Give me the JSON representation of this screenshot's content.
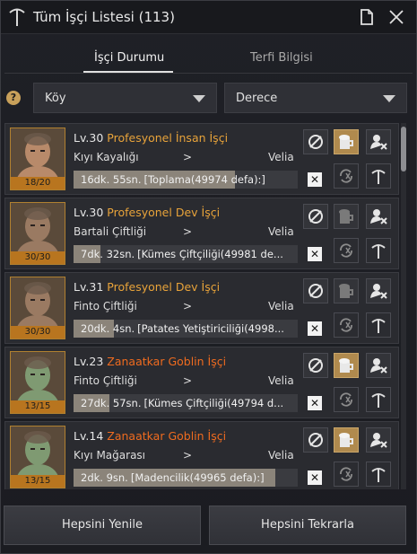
{
  "window": {
    "title": "Tüm İşçi Listesi (113)"
  },
  "tabs": [
    {
      "label": "İşçi Durumu",
      "active": true
    },
    {
      "label": "Terfi Bilgisi",
      "active": false
    }
  ],
  "filters": {
    "help_symbol": "?",
    "node_dropdown": "Köy",
    "grade_dropdown": "Derece"
  },
  "workers": [
    {
      "level": "Lv.30",
      "type": "Profesyonel İnsan İşçi",
      "type_color": "#e8a33a",
      "stamina": "18/20",
      "node": "Kıyı Kayalığı",
      "arrow": ">",
      "town": "Velia",
      "time": "16dk. 55sn.",
      "job": "[Toplama(49974 defa):]",
      "progress": 0.72,
      "skin": "#b88a6a",
      "gather_active": true
    },
    {
      "level": "Lv.30",
      "type": "Profesyonel Dev İşçi",
      "type_color": "#e8a33a",
      "stamina": "30/30",
      "node": "Bartali Çiftliği",
      "arrow": ">",
      "town": "Velia",
      "time": "7dk. 32sn.",
      "job": "[Kümes Çiftçiliği(49981 de...",
      "progress": 0.12,
      "skin": "#9a7a62",
      "gather_active": false
    },
    {
      "level": "Lv.31",
      "type": "Profesyonel Dev İşçi",
      "type_color": "#e8a33a",
      "stamina": "30/30",
      "node": "Finto Çiftliği",
      "arrow": ">",
      "town": "Velia",
      "time": "20dk. 4sn.",
      "job": "[Patates Yetiştiriciliği(4998...",
      "progress": 0.18,
      "skin": "#9a7a62",
      "gather_active": false
    },
    {
      "level": "Lv.23",
      "type": "Zanaatkar Goblin İşçi",
      "type_color": "#ef6b1f",
      "stamina": "13/15",
      "node": "Finto Çiftliği",
      "arrow": ">",
      "town": "Velia",
      "time": "27dk. 57sn.",
      "job": "[Kümes Çiftçiliği(49794 d...",
      "progress": 0.16,
      "skin": "#7f9a72",
      "gather_active": true
    },
    {
      "level": "Lv.14",
      "type": "Zanaatkar Goblin İşçi",
      "type_color": "#ef6b1f",
      "stamina": "13/15",
      "node": "Kıyı Mağarası",
      "arrow": ">",
      "town": "Velia",
      "time": "2dk. 9sn.",
      "job": "[Madencilik(49965 defa):]",
      "progress": 0.9,
      "skin": "#7f9a72",
      "gather_active": true
    }
  ],
  "cancel_symbol": "✕",
  "footer": {
    "refresh_all": "Hepsini Yenile",
    "repeat_all": "Hepsini Tekrarla"
  }
}
